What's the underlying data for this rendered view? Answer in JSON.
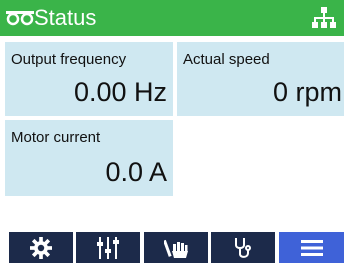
{
  "header": {
    "title": "Status",
    "left_icon": "glasses-icon",
    "right_icon": "network-icon",
    "color": "#3ab449"
  },
  "tiles": [
    {
      "label": "Output frequency",
      "value": "0.00 Hz"
    },
    {
      "label": "Actual speed",
      "value": "0 rpm"
    },
    {
      "label": "Motor current",
      "value": "0.0 A"
    }
  ],
  "tile_color": "#cfe8f1",
  "toolbar": {
    "buttons": [
      {
        "icon": "gear-icon"
      },
      {
        "icon": "sliders-icon"
      },
      {
        "icon": "hand-icon"
      },
      {
        "icon": "stethoscope-icon"
      },
      {
        "icon": "menu-icon",
        "active": true
      }
    ],
    "button_color": "#1c2a4a",
    "active_color": "#3f62d8"
  }
}
